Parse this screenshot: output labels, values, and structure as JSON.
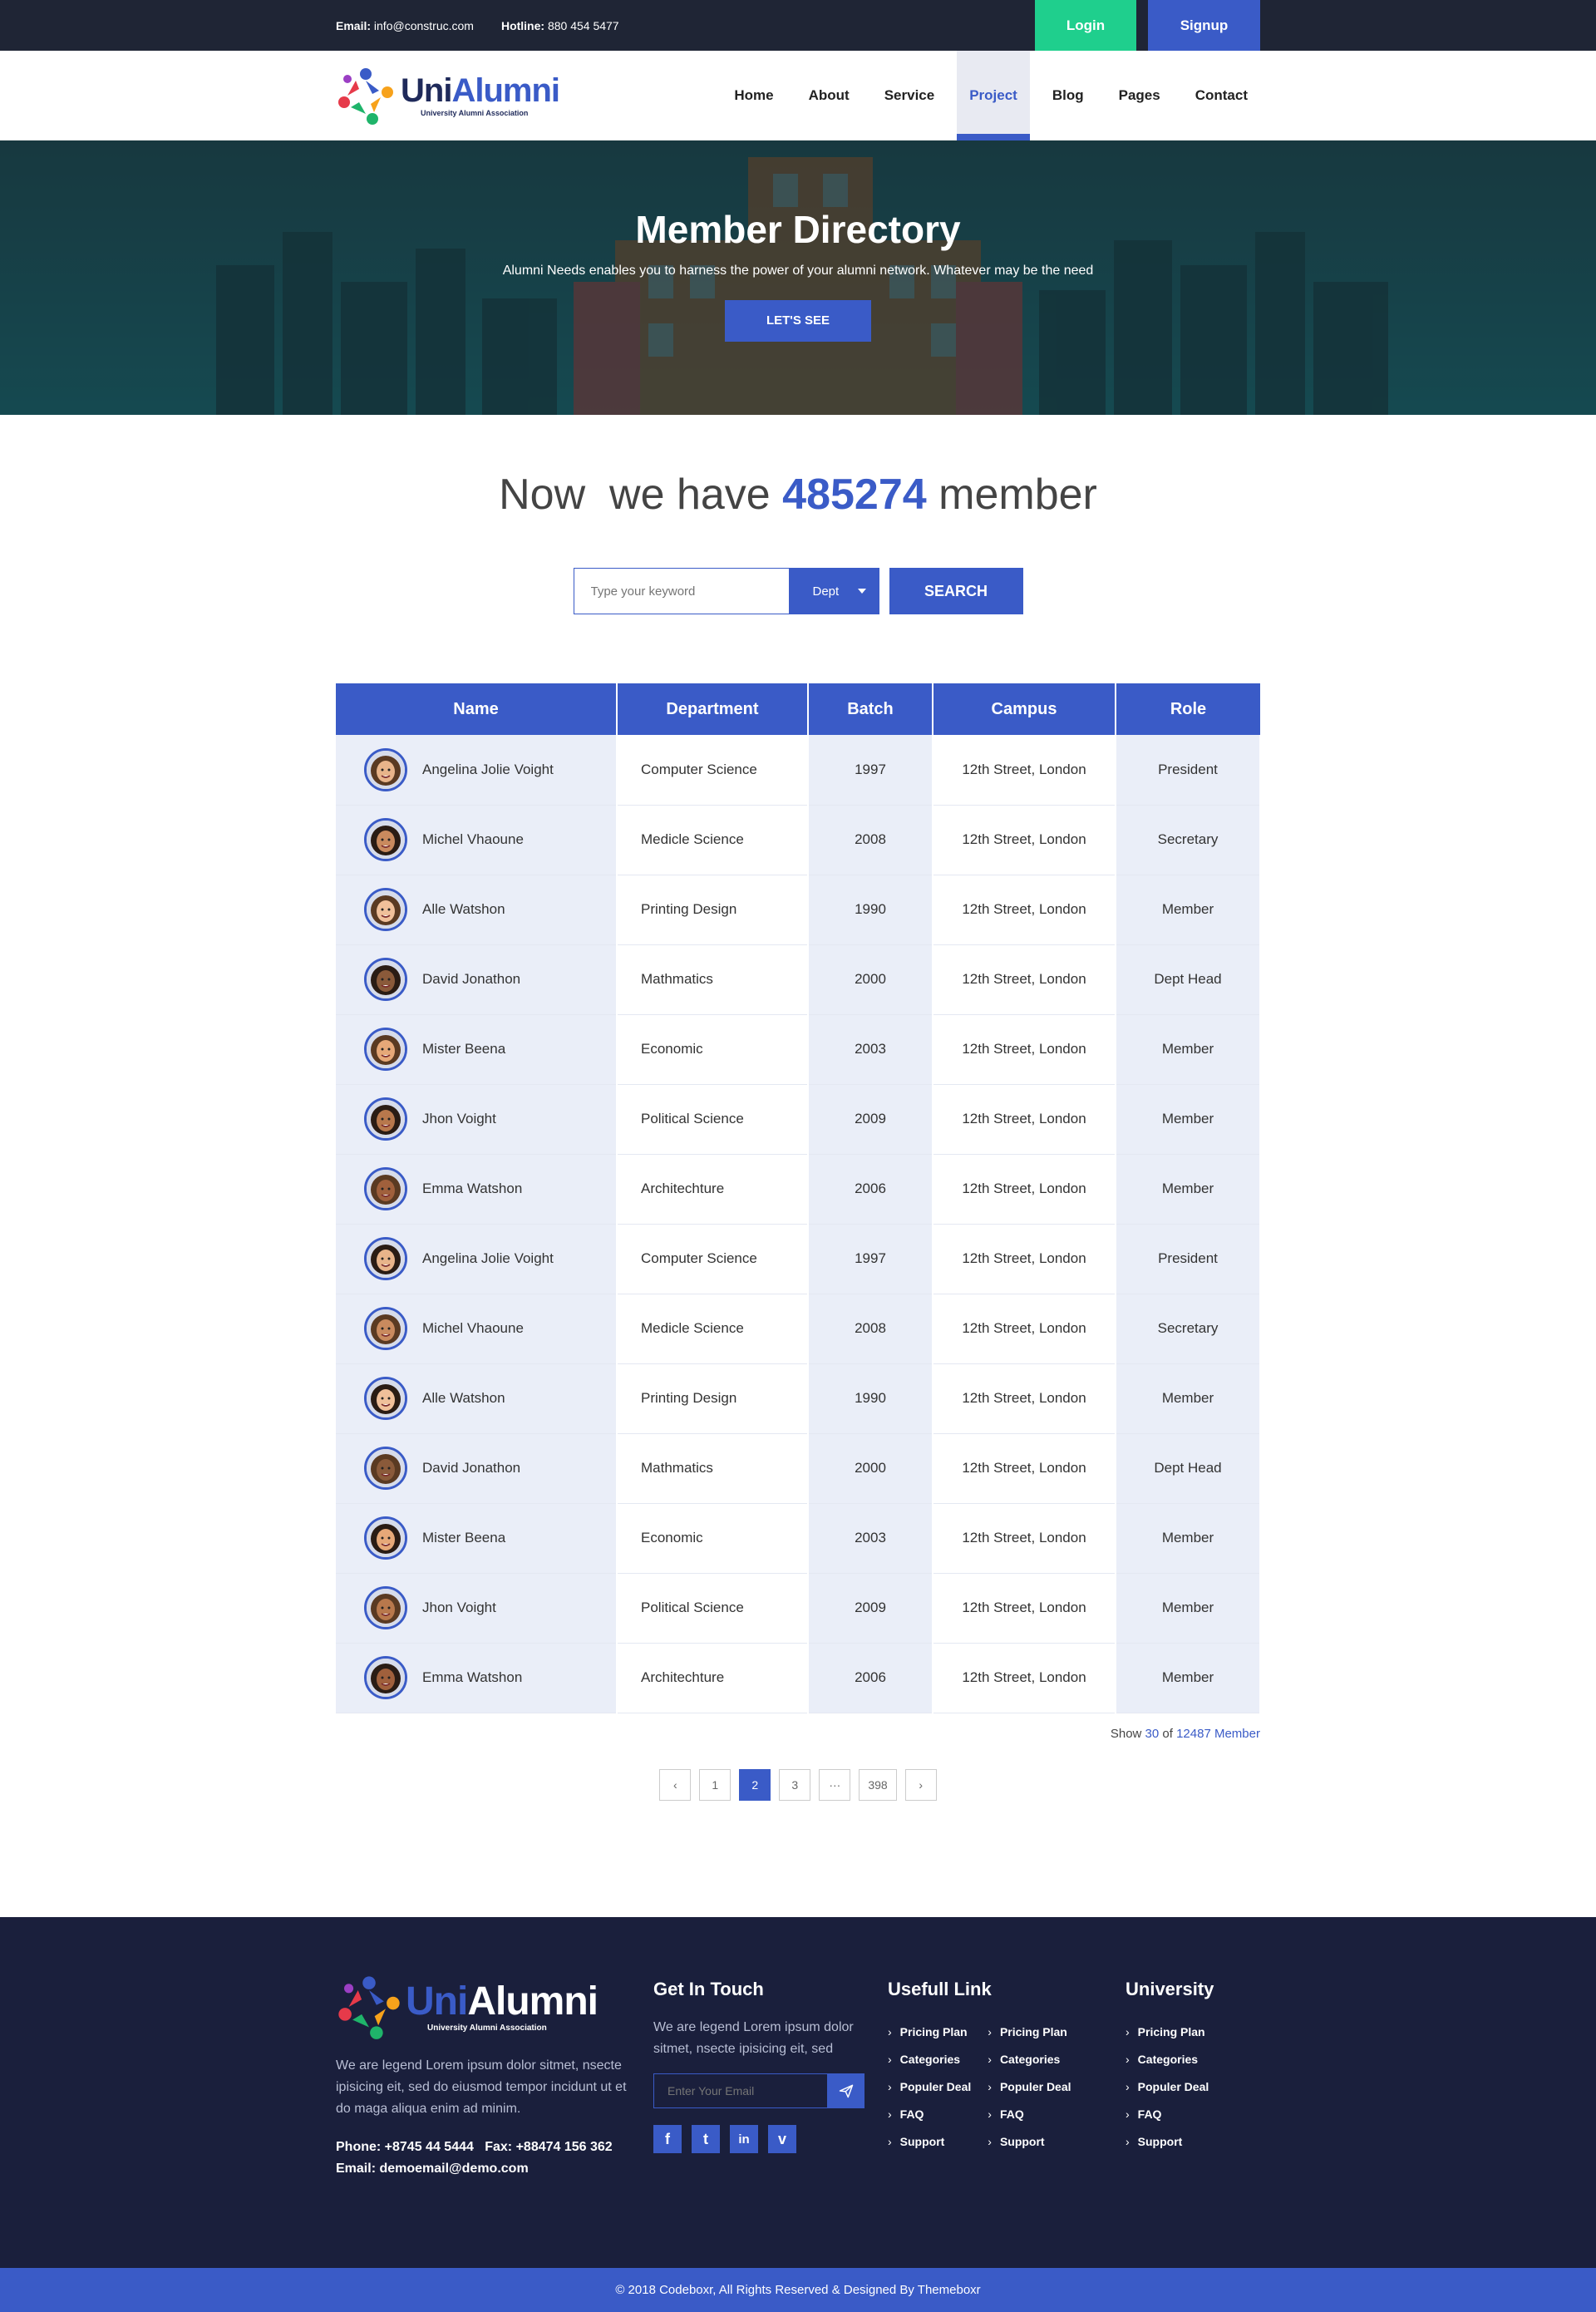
{
  "topbar": {
    "email_label": "Email:",
    "email_value": "info@construc.com",
    "hotline_label": "Hotline:",
    "hotline_value": "880 454 5477",
    "login_label": "Login",
    "signup_label": "Signup"
  },
  "brand": {
    "uni": "Uni",
    "alumni": "Alumni",
    "tagline": "University Alumni Association"
  },
  "nav": {
    "items": [
      "Home",
      "About",
      "Service",
      "Project",
      "Blog",
      "Pages",
      "Contact"
    ],
    "active": "Project"
  },
  "hero": {
    "title": "Member Directory",
    "subtitle": "Alumni Needs enables you to harness the power of your alumni network. Whatever may be the need",
    "button": "LET'S SEE"
  },
  "stats": {
    "prefix": "Now  we have",
    "count": "485274",
    "suffix": "member"
  },
  "search": {
    "placeholder": "Type your keyword",
    "dept_label": "Dept",
    "button": "SEARCH"
  },
  "table": {
    "headers": [
      "Name",
      "Department",
      "Batch",
      "Campus",
      "Role"
    ],
    "rows": [
      {
        "name": "Angelina Jolie Voight",
        "dept": "Computer Science",
        "batch": "1997",
        "campus": "12th Street, London",
        "role": "President"
      },
      {
        "name": "Michel Vhaoune",
        "dept": "Medicle Science",
        "batch": "2008",
        "campus": "12th Street, London",
        "role": "Secretary"
      },
      {
        "name": "Alle Watshon",
        "dept": "Printing Design",
        "batch": "1990",
        "campus": "12th Street, London",
        "role": "Member"
      },
      {
        "name": "David Jonathon",
        "dept": "Mathmatics",
        "batch": "2000",
        "campus": "12th Street, London",
        "role": "Dept Head"
      },
      {
        "name": "Mister Beena",
        "dept": "Economic",
        "batch": "2003",
        "campus": "12th Street, London",
        "role": "Member"
      },
      {
        "name": "Jhon Voight",
        "dept": "Political Science",
        "batch": "2009",
        "campus": "12th Street, London",
        "role": "Member"
      },
      {
        "name": "Emma Watshon",
        "dept": "Architechture",
        "batch": "2006",
        "campus": "12th Street, London",
        "role": "Member"
      },
      {
        "name": "Angelina Jolie Voight",
        "dept": "Computer Science",
        "batch": "1997",
        "campus": "12th Street, London",
        "role": "President"
      },
      {
        "name": "Michel Vhaoune",
        "dept": "Medicle Science",
        "batch": "2008",
        "campus": "12th Street, London",
        "role": "Secretary"
      },
      {
        "name": "Alle Watshon",
        "dept": "Printing Design",
        "batch": "1990",
        "campus": "12th Street, London",
        "role": "Member"
      },
      {
        "name": "David Jonathon",
        "dept": "Mathmatics",
        "batch": "2000",
        "campus": "12th Street, London",
        "role": "Dept Head"
      },
      {
        "name": "Mister Beena",
        "dept": "Economic",
        "batch": "2003",
        "campus": "12th Street, London",
        "role": "Member"
      },
      {
        "name": "Jhon Voight",
        "dept": "Political Science",
        "batch": "2009",
        "campus": "12th Street, London",
        "role": "Member"
      },
      {
        "name": "Emma Watshon",
        "dept": "Architechture",
        "batch": "2006",
        "campus": "12th Street, London",
        "role": "Member"
      }
    ]
  },
  "summary": {
    "show": "Show",
    "shown": "30",
    "of": "of",
    "total": "12487 Member"
  },
  "pagination": {
    "prev": "‹",
    "pages": [
      "1",
      "2",
      "3",
      "···",
      "398"
    ],
    "active": "2",
    "next": "›"
  },
  "footer": {
    "about": "We are legend Lorem ipsum dolor sitmet, nsecte ipisicing eit, sed do eiusmod tempor incidunt ut et do maga aliqua enim ad minim.",
    "phone": "Phone: +8745 44 5444",
    "fax": "Fax: +88474 156 362",
    "email": "Email: demoemail@demo.com",
    "touch_title": "Get In Touch",
    "touch_text": "We are legend Lorem ipsum dolor sitmet, nsecte ipisicing eit, sed",
    "subscribe_placeholder": "Enter Your Email",
    "socials": [
      "f",
      "t",
      "in",
      "v"
    ],
    "useful_title": "Usefull Link",
    "useful_col1": [
      "Pricing Plan",
      "Categories",
      "Populer Deal",
      "FAQ",
      "Support"
    ],
    "useful_col2": [
      "Pricing Plan",
      "Categories",
      "Populer Deal",
      "FAQ",
      "Support"
    ],
    "university_title": "University",
    "university_links": [
      "Pricing Plan",
      "Categories",
      "Populer Deal",
      "FAQ",
      "Support"
    ],
    "copyright": "© 2018 Codeboxr, All Rights Reserved & Designed By Themeboxr"
  },
  "colors": {
    "primary": "#3a5bc7",
    "accent_green": "#1fcf8d",
    "dark": "#1f2535",
    "footer_bg": "#1a1f3c"
  }
}
